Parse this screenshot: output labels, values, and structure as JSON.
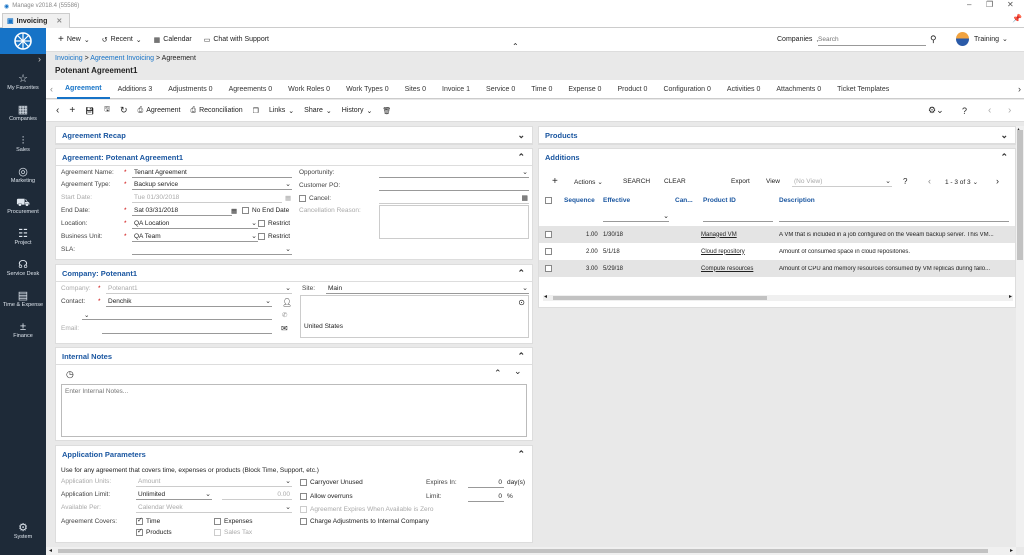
{
  "window": {
    "title": "Manage v2018.4 (55586)",
    "min": "–",
    "max": "❐",
    "close": "✕"
  },
  "doc_tab": {
    "label": "Invoicing",
    "close": "✕"
  },
  "sidebar": {
    "items": [
      {
        "label": "My Favorites",
        "icon": "star-icon",
        "glyph": "☆"
      },
      {
        "label": "Companies",
        "icon": "building-icon",
        "glyph": "▦"
      },
      {
        "label": "Sales",
        "icon": "chart-icon",
        "glyph": "⫶"
      },
      {
        "label": "Marketing",
        "icon": "target-icon",
        "glyph": "◎"
      },
      {
        "label": "Procurement",
        "icon": "cart-icon",
        "glyph": "⛟"
      },
      {
        "label": "Project",
        "icon": "gantt-icon",
        "glyph": "☷"
      },
      {
        "label": "Service Desk",
        "icon": "headset-icon",
        "glyph": "☊"
      },
      {
        "label": "Time & Expense",
        "icon": "calendar-icon",
        "glyph": "▤"
      },
      {
        "label": "Finance",
        "icon": "calculator-icon",
        "glyph": "±"
      }
    ],
    "system": {
      "label": "System",
      "glyph": "⚙"
    }
  },
  "topbar": {
    "new": "New",
    "recent": "Recent",
    "calendar": "Calendar",
    "chat": "Chat with Support",
    "companies": "Companies",
    "search_placeholder": "Search",
    "user": "Training"
  },
  "breadcrumb": {
    "p1": "Invoicing",
    "sep": " > ",
    "p2": "Agreement Invoicing",
    "p3": "Agreement"
  },
  "page_title": "Potenant Agreement1",
  "tabs": [
    "Agreement",
    "Additions 3",
    "Adjustments 0",
    "Agreements 0",
    "Work Roles 0",
    "Work Types 0",
    "Sites 0",
    "Invoice 1",
    "Service 0",
    "Time 0",
    "Expense 0",
    "Product 0",
    "Configuration 0",
    "Activities 0",
    "Attachments 0",
    "Ticket Templates"
  ],
  "toolbar": {
    "agreement": "Agreement",
    "reconciliation": "Reconciliation",
    "links": "Links",
    "share": "Share",
    "history": "History"
  },
  "recap": {
    "title": "Agreement Recap"
  },
  "agreement": {
    "title": "Agreement: Potenant Agreement1",
    "name_label": "Agreement Name:",
    "name": "Tenant Agreement",
    "type_label": "Agreement Type:",
    "type": "Backup service",
    "start_label": "Start Date:",
    "start": "Tue 01/30/2018",
    "end_label": "End Date:",
    "end": "Sat 03/31/2018",
    "no_end": "No End Date",
    "location_label": "Location:",
    "location": "QA Location",
    "restrict1": "Restrict",
    "bu_label": "Business Unit:",
    "bu": "QA Team",
    "restrict2": "Restrict",
    "sla_label": "SLA:",
    "opp_label": "Opportunity:",
    "po_label": "Customer PO:",
    "cancel_label": "Cancel:",
    "cancel_reason_label": "Cancellation Reason:"
  },
  "company": {
    "title": "Company: Potenant1",
    "company_label": "Company:",
    "company": "Potenant1",
    "contact_label": "Contact:",
    "contact": "Denchik",
    "email_label": "Email:",
    "site_label": "Site:",
    "site": "Main",
    "country": "United States"
  },
  "notes": {
    "title": "Internal Notes",
    "placeholder": "Enter Internal Notes..."
  },
  "params": {
    "title": "Application Parameters",
    "desc": "Use for any agreement that covers time, expenses or products (Block Time, Support, etc.)",
    "units_label": "Application Units:",
    "units": "Amount",
    "limit_label": "Application Limit:",
    "limit": "Unlimited",
    "limit_amt": "0.00",
    "per_label": "Available Per:",
    "per": "Calendar Week",
    "covers_label": "Agreement Covers:",
    "time": "Time",
    "products": "Products",
    "expenses": "Expenses",
    "sales_tax": "Sales Tax",
    "carryover": "Carryover Unused",
    "overruns": "Allow overruns",
    "expires_zero": "Agreement Expires When Available is Zero",
    "charge_adj": "Charge Adjustments to Internal Company",
    "expires_in_label": "Expires In:",
    "expires_in": "0",
    "days": "day(s)",
    "limit2_label": "Limit:",
    "limit2": "0",
    "pct": "%"
  },
  "products": {
    "title": "Products"
  },
  "additions": {
    "title": "Additions",
    "actions": "Actions",
    "search": "SEARCH",
    "clear": "CLEAR",
    "export": "Export",
    "view": "View",
    "view_value": "(No View)",
    "paging": "1 - 3 of 3",
    "columns": [
      "Sequence",
      "Effective",
      "Can...",
      "Product ID",
      "Description"
    ],
    "rows": [
      {
        "seq": "1.00",
        "eff": "1/30/18",
        "pid": "Managed VM",
        "desc": "A VM that is included in a job configured on the Veeam backup server. This VM..."
      },
      {
        "seq": "2.00",
        "eff": "5/1/18",
        "pid": "Cloud repository",
        "desc": "Amount of consumed space in cloud repositories."
      },
      {
        "seq": "3.00",
        "eff": "5/29/18",
        "pid": "Compute resources",
        "desc": "Amount of CPU and memory resources consumed by VM replicas during failo..."
      }
    ]
  },
  "colors": {
    "accent": "#1673c7",
    "sidebar": "#1e2a38",
    "header_text": "#1a56a0"
  }
}
